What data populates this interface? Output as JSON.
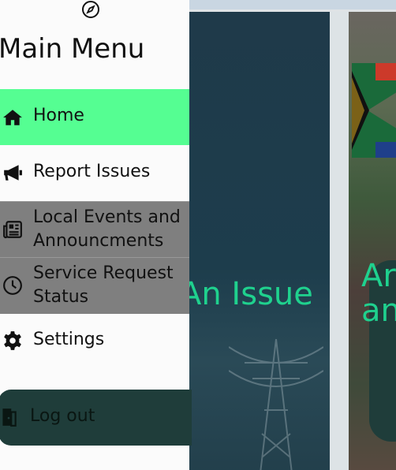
{
  "drawer": {
    "title": "Main Menu",
    "items": [
      {
        "label": "Home",
        "icon": "home-icon"
      },
      {
        "label": "Report Issues",
        "icon": "megaphone-icon"
      },
      {
        "label": "Local Events and Announcments",
        "icon": "newspaper-icon"
      },
      {
        "label": "Service Request Status",
        "icon": "clock-icon"
      },
      {
        "label": "Settings",
        "icon": "gear-icon"
      }
    ],
    "logout": {
      "label": "Log out",
      "icon": "door-exit-icon"
    }
  },
  "background": {
    "card_left_text": "An Issue",
    "card_right_text_line1": "Ar",
    "card_right_text_line2": "an"
  },
  "colors": {
    "active_item": "#55fe92",
    "highlight_items": "#7f7f7f",
    "logout_bg": "#1f3d3a",
    "card_text": "#1fd18e"
  }
}
